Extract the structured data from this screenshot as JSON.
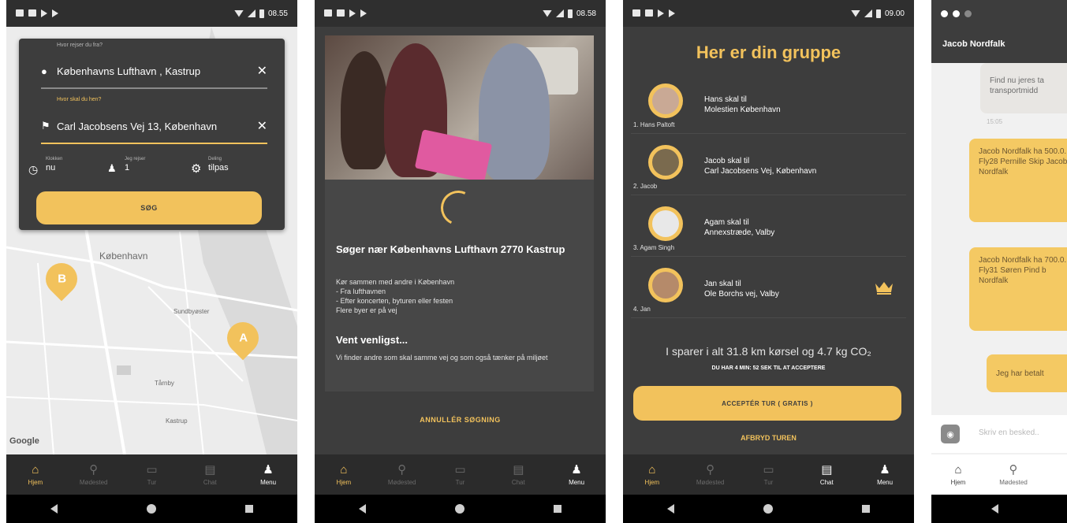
{
  "status": {
    "time1": "08.55",
    "time2": "08.58",
    "time3": "09.00"
  },
  "nav": {
    "home": "Hjem",
    "meetpoint": "Mødested",
    "trip": "Tur",
    "chat": "Chat",
    "menu": "Menu"
  },
  "screen1": {
    "from_label": "Hvor rejser du fra?",
    "from_value": "Københavns Lufthavn , Kastrup",
    "to_label": "Hvor skal du hen?",
    "to_value": "Carl Jacobsens Vej 13, København",
    "time_label": "Klokken",
    "time_value": "nu",
    "people_label": "Jeg rejser",
    "people_value": "1",
    "share_label": "Deling",
    "share_value": "tilpas",
    "search_button": "SØG",
    "map_labels": {
      "city": "København",
      "sundbyoster": "Sundbyøster",
      "tarnby": "Tårnby",
      "kastrup": "Kastrup",
      "google": "Google"
    },
    "marker_b": "B",
    "marker_a": "A"
  },
  "screen2": {
    "title": "Søger nær Københavns Lufthavn 2770 Kastrup",
    "body_lines": [
      "Kør sammen med andre i København",
      "- Fra lufthavnen",
      "- Efter koncerten, byturen eller festen",
      "Flere byer er på vej"
    ],
    "wait_title": "Vent venligst...",
    "wait_body": "Vi finder andre som skal samme vej og som også tænker på miljøet",
    "cancel": "ANNULLÉR SØGNING"
  },
  "screen3": {
    "title": "Her er din gruppe",
    "members": [
      {
        "num": "1. Hans Paltoft",
        "line1": "Hans skal til",
        "line2": "Molestien  København"
      },
      {
        "num": "2. Jacob",
        "line1": "Jacob skal til",
        "line2": "Carl Jacobsens Vej,  København"
      },
      {
        "num": "3. Agam Singh",
        "line1": "Agam skal til",
        "line2": "Annexstræde,  Valby"
      },
      {
        "num": "4. Jan",
        "line1": "Jan skal til",
        "line2": "Ole Borchs vej,  Valby"
      }
    ],
    "savings": "I sparer i alt 31.8 km kørsel og 4.7 kg CO₂",
    "deadline": "DU HAR 4 MIN: 52 SEK TIL AT ACCEPTERE",
    "accept": "ACCEPTÉR TUR ( GRATIS )",
    "abort": "AFBRYD TUREN"
  },
  "screen4": {
    "header": "Jacob Nordfalk",
    "msg_gray": "Find nu jeres ta transportmidd",
    "msg_gray_time": "15:05",
    "msg1": "Jacob Nordfalk ha 500.0. Fly28 Pernille Skip Jacob Nordfalk",
    "msg2": "Jacob Nordfalk ha 700.0. Fly31 Søren Pind b Nordfalk",
    "paid_button": "Jeg har betalt",
    "input_placeholder": "Skriv en besked..",
    "nav_home": "Hjem",
    "nav_meet": "Mødested"
  },
  "colors": {
    "accent": "#f2c25c",
    "panel": "#3d3d3d"
  }
}
